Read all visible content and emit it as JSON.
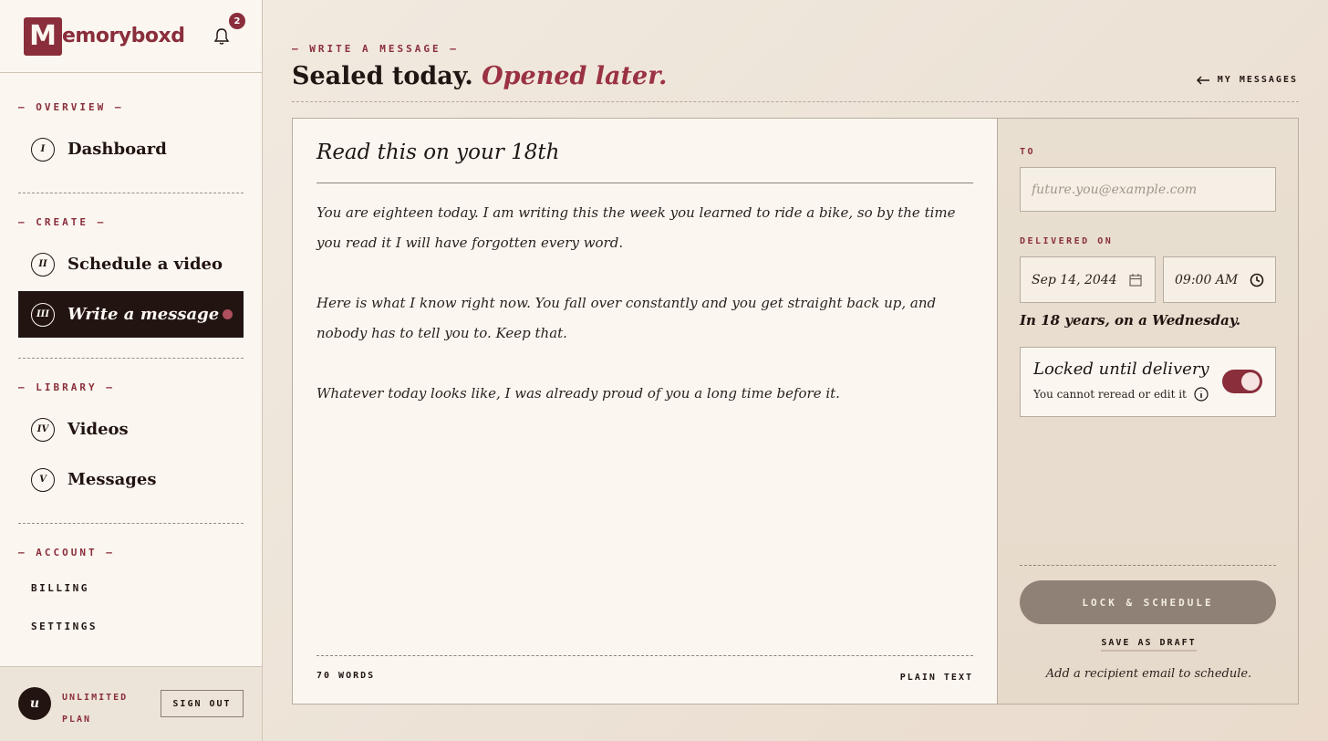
{
  "brand": {
    "logo_letter": "M",
    "logo_text": "emoryboxd",
    "notification_count": "2"
  },
  "sidebar": {
    "sections": {
      "overview": "— OVERVIEW —",
      "create": "— CREATE —",
      "library": "— LIBRARY —",
      "account": "— ACCOUNT —"
    },
    "items": [
      {
        "numeral": "I",
        "label": "Dashboard"
      },
      {
        "numeral": "II",
        "label": "Schedule a video"
      },
      {
        "numeral": "III",
        "label": "Write a message",
        "active": true
      },
      {
        "numeral": "IV",
        "label": "Videos"
      },
      {
        "numeral": "V",
        "label": "Messages"
      }
    ],
    "account_links": [
      "BILLING",
      "SETTINGS"
    ],
    "footer": {
      "avatar_initial": "u",
      "plan_line1": "UNLIMITED",
      "plan_line2": "PLAN",
      "sign_out": "SIGN OUT"
    }
  },
  "header": {
    "eyebrow": "— WRITE A MESSAGE —",
    "title_plain": "Sealed today.",
    "title_accent": "Opened later.",
    "back_link": "MY MESSAGES"
  },
  "editor": {
    "title": "Read this on your 18th",
    "paragraphs": [
      "You are eighteen today. I am writing this the week you learned to ride a bike, so by the time you read it I will have forgotten every word.",
      "Here is what I know right now. You fall over constantly and you get straight back up, and nobody has to tell you to. Keep that.",
      "Whatever today looks like, I was already proud of you a long time before it."
    ],
    "word_count": "70 WORDS",
    "format": "PLAIN TEXT"
  },
  "panel": {
    "to_label": "TO",
    "to_placeholder": "future.you@example.com",
    "delivered_label": "DELIVERED ON",
    "date_value": "Sep 14, 2044",
    "time_value": "09:00 AM",
    "delivery_note": "In 18 years, on a Wednesday.",
    "lock_title": "Locked until delivery",
    "lock_sub": "You cannot reread or edit it",
    "lock_enabled": true,
    "lock_button": "LOCK & SCHEDULE",
    "draft_link": "SAVE AS DRAFT",
    "hint": "Add a recipient email to schedule."
  },
  "colors": {
    "accent": "#8a2e3c",
    "dark": "#221411",
    "paper": "#fbf7f0"
  },
  "icons": [
    "bell-icon",
    "calendar-icon",
    "clock-icon",
    "info-icon",
    "arrow-left-icon"
  ]
}
